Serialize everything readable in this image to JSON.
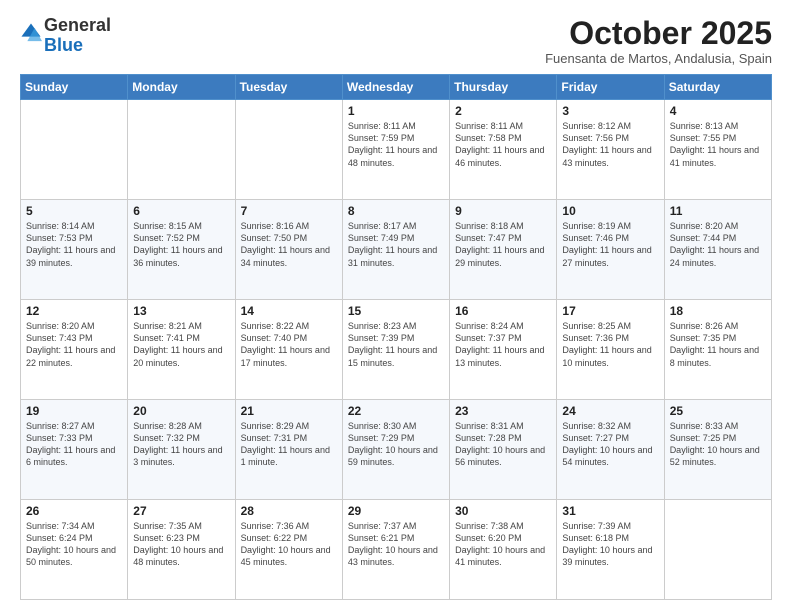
{
  "logo": {
    "general": "General",
    "blue": "Blue"
  },
  "header": {
    "month": "October 2025",
    "location": "Fuensanta de Martos, Andalusia, Spain"
  },
  "days_of_week": [
    "Sunday",
    "Monday",
    "Tuesday",
    "Wednesday",
    "Thursday",
    "Friday",
    "Saturday"
  ],
  "weeks": [
    [
      {
        "day": "",
        "info": ""
      },
      {
        "day": "",
        "info": ""
      },
      {
        "day": "",
        "info": ""
      },
      {
        "day": "1",
        "info": "Sunrise: 8:11 AM\nSunset: 7:59 PM\nDaylight: 11 hours and 48 minutes."
      },
      {
        "day": "2",
        "info": "Sunrise: 8:11 AM\nSunset: 7:58 PM\nDaylight: 11 hours and 46 minutes."
      },
      {
        "day": "3",
        "info": "Sunrise: 8:12 AM\nSunset: 7:56 PM\nDaylight: 11 hours and 43 minutes."
      },
      {
        "day": "4",
        "info": "Sunrise: 8:13 AM\nSunset: 7:55 PM\nDaylight: 11 hours and 41 minutes."
      }
    ],
    [
      {
        "day": "5",
        "info": "Sunrise: 8:14 AM\nSunset: 7:53 PM\nDaylight: 11 hours and 39 minutes."
      },
      {
        "day": "6",
        "info": "Sunrise: 8:15 AM\nSunset: 7:52 PM\nDaylight: 11 hours and 36 minutes."
      },
      {
        "day": "7",
        "info": "Sunrise: 8:16 AM\nSunset: 7:50 PM\nDaylight: 11 hours and 34 minutes."
      },
      {
        "day": "8",
        "info": "Sunrise: 8:17 AM\nSunset: 7:49 PM\nDaylight: 11 hours and 31 minutes."
      },
      {
        "day": "9",
        "info": "Sunrise: 8:18 AM\nSunset: 7:47 PM\nDaylight: 11 hours and 29 minutes."
      },
      {
        "day": "10",
        "info": "Sunrise: 8:19 AM\nSunset: 7:46 PM\nDaylight: 11 hours and 27 minutes."
      },
      {
        "day": "11",
        "info": "Sunrise: 8:20 AM\nSunset: 7:44 PM\nDaylight: 11 hours and 24 minutes."
      }
    ],
    [
      {
        "day": "12",
        "info": "Sunrise: 8:20 AM\nSunset: 7:43 PM\nDaylight: 11 hours and 22 minutes."
      },
      {
        "day": "13",
        "info": "Sunrise: 8:21 AM\nSunset: 7:41 PM\nDaylight: 11 hours and 20 minutes."
      },
      {
        "day": "14",
        "info": "Sunrise: 8:22 AM\nSunset: 7:40 PM\nDaylight: 11 hours and 17 minutes."
      },
      {
        "day": "15",
        "info": "Sunrise: 8:23 AM\nSunset: 7:39 PM\nDaylight: 11 hours and 15 minutes."
      },
      {
        "day": "16",
        "info": "Sunrise: 8:24 AM\nSunset: 7:37 PM\nDaylight: 11 hours and 13 minutes."
      },
      {
        "day": "17",
        "info": "Sunrise: 8:25 AM\nSunset: 7:36 PM\nDaylight: 11 hours and 10 minutes."
      },
      {
        "day": "18",
        "info": "Sunrise: 8:26 AM\nSunset: 7:35 PM\nDaylight: 11 hours and 8 minutes."
      }
    ],
    [
      {
        "day": "19",
        "info": "Sunrise: 8:27 AM\nSunset: 7:33 PM\nDaylight: 11 hours and 6 minutes."
      },
      {
        "day": "20",
        "info": "Sunrise: 8:28 AM\nSunset: 7:32 PM\nDaylight: 11 hours and 3 minutes."
      },
      {
        "day": "21",
        "info": "Sunrise: 8:29 AM\nSunset: 7:31 PM\nDaylight: 11 hours and 1 minute."
      },
      {
        "day": "22",
        "info": "Sunrise: 8:30 AM\nSunset: 7:29 PM\nDaylight: 10 hours and 59 minutes."
      },
      {
        "day": "23",
        "info": "Sunrise: 8:31 AM\nSunset: 7:28 PM\nDaylight: 10 hours and 56 minutes."
      },
      {
        "day": "24",
        "info": "Sunrise: 8:32 AM\nSunset: 7:27 PM\nDaylight: 10 hours and 54 minutes."
      },
      {
        "day": "25",
        "info": "Sunrise: 8:33 AM\nSunset: 7:25 PM\nDaylight: 10 hours and 52 minutes."
      }
    ],
    [
      {
        "day": "26",
        "info": "Sunrise: 7:34 AM\nSunset: 6:24 PM\nDaylight: 10 hours and 50 minutes."
      },
      {
        "day": "27",
        "info": "Sunrise: 7:35 AM\nSunset: 6:23 PM\nDaylight: 10 hours and 48 minutes."
      },
      {
        "day": "28",
        "info": "Sunrise: 7:36 AM\nSunset: 6:22 PM\nDaylight: 10 hours and 45 minutes."
      },
      {
        "day": "29",
        "info": "Sunrise: 7:37 AM\nSunset: 6:21 PM\nDaylight: 10 hours and 43 minutes."
      },
      {
        "day": "30",
        "info": "Sunrise: 7:38 AM\nSunset: 6:20 PM\nDaylight: 10 hours and 41 minutes."
      },
      {
        "day": "31",
        "info": "Sunrise: 7:39 AM\nSunset: 6:18 PM\nDaylight: 10 hours and 39 minutes."
      },
      {
        "day": "",
        "info": ""
      }
    ]
  ]
}
